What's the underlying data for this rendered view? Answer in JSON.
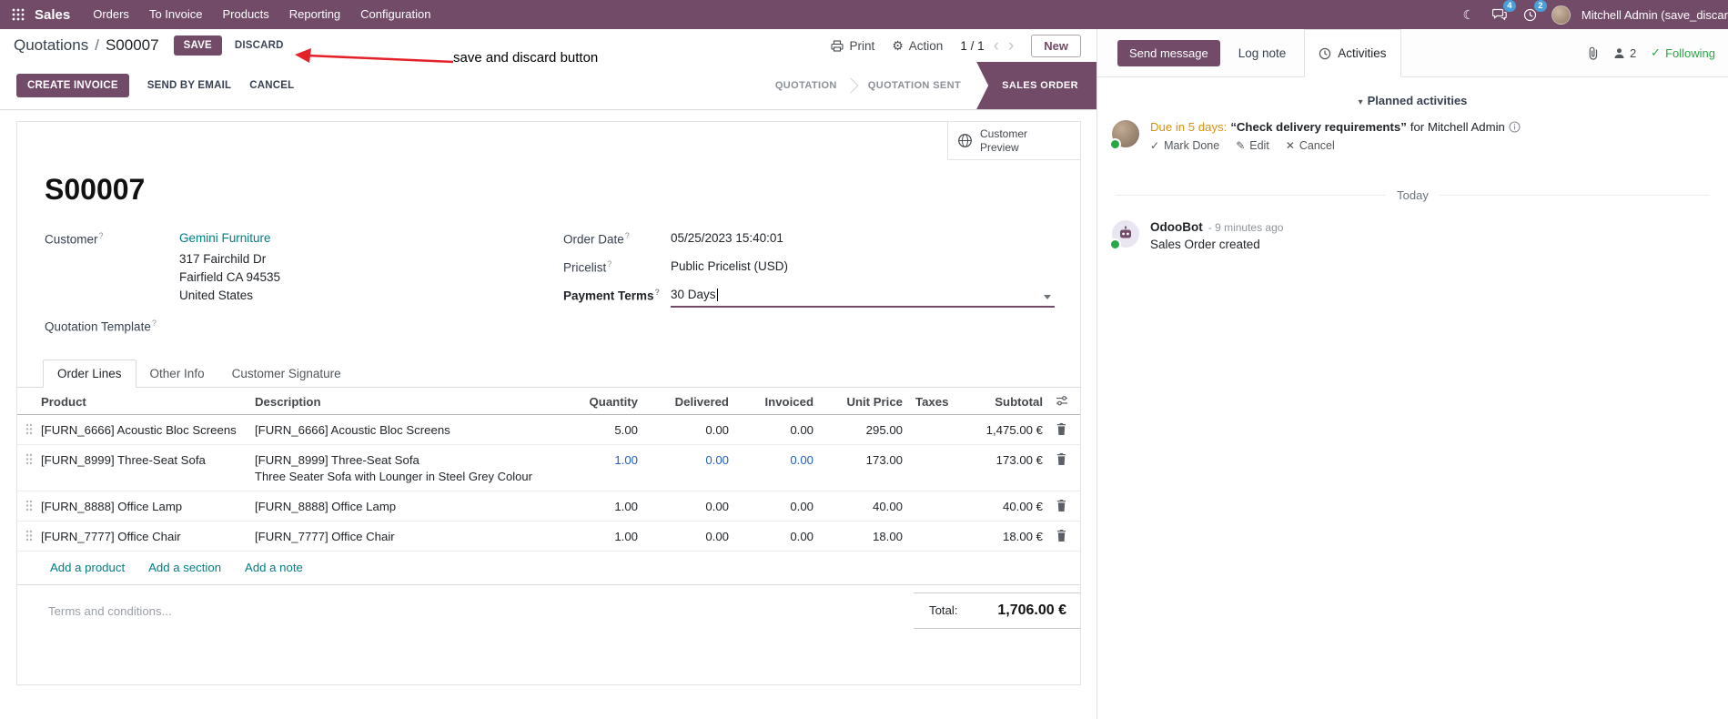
{
  "colors": {
    "primary": "#714B67",
    "link_teal": "#017e84",
    "modified_value_blue": "#2160c4",
    "following_green": "#28a745",
    "activity_due_orange": "#d9930d",
    "annotation_red": "#e32228",
    "topbar_badge_blue": "#4a9ed9"
  },
  "icons": {
    "gear": "⚙",
    "moon": "☾",
    "chevron_left": "‹",
    "chevron_right": "›",
    "caret_down": "▾",
    "check": "✓",
    "pencil": "✎",
    "cross": "✕"
  },
  "topbar": {
    "brand": "Sales",
    "menus": [
      "Orders",
      "To Invoice",
      "Products",
      "Reporting",
      "Configuration"
    ],
    "messages_badge": "4",
    "activities_badge": "2",
    "user_name": "Mitchell Admin (save_discar"
  },
  "control_panel": {
    "breadcrumb_parent": "Quotations",
    "separator": "/",
    "breadcrumb_current": "S00007",
    "save": "SAVE",
    "discard": "DISCARD",
    "print": "Print",
    "action": "Action",
    "pager": "1 / 1",
    "new": "New"
  },
  "annotation": {
    "label": "save and discard button"
  },
  "statusbar": {
    "create_invoice": "CREATE INVOICE",
    "send_by_email": "SEND BY EMAIL",
    "cancel": "CANCEL",
    "steps": [
      "QUOTATION",
      "QUOTATION SENT",
      "SALES ORDER"
    ]
  },
  "sheet": {
    "customer_preview": "Customer Preview",
    "title": "S00007",
    "help_marker": "?",
    "fields": {
      "customer_label": "Customer",
      "customer_value": "Gemini Furniture",
      "customer_address": [
        "317 Fairchild Dr",
        "Fairfield CA 94535",
        "United States"
      ],
      "quotation_template_label": "Quotation Template",
      "order_date_label": "Order Date",
      "order_date_value": "05/25/2023 15:40:01",
      "pricelist_label": "Pricelist",
      "pricelist_value": "Public Pricelist (USD)",
      "payment_terms_label": "Payment Terms",
      "payment_terms_value": "30 Days"
    },
    "tabs": [
      "Order Lines",
      "Other Info",
      "Customer Signature"
    ],
    "table": {
      "headers": [
        "Product",
        "Description",
        "Quantity",
        "Delivered",
        "Invoiced",
        "Unit Price",
        "Taxes",
        "Subtotal"
      ],
      "rows": [
        {
          "product": "[FURN_6666] Acoustic Bloc Screens",
          "description": "[FURN_6666] Acoustic Bloc Screens",
          "description2": "",
          "quantity": "5.00",
          "delivered": "0.00",
          "invoiced": "0.00",
          "unit_price": "295.00",
          "taxes": "",
          "subtotal": "1,475.00 €"
        },
        {
          "product": "[FURN_8999] Three-Seat Sofa",
          "description": "[FURN_8999] Three-Seat Sofa",
          "description2": "Three Seater Sofa with Lounger in Steel Grey Colour",
          "quantity": "1.00",
          "delivered": "0.00",
          "invoiced": "0.00",
          "unit_price": "173.00",
          "taxes": "",
          "subtotal": "173.00 €"
        },
        {
          "product": "[FURN_8888] Office Lamp",
          "description": "[FURN_8888] Office Lamp",
          "description2": "",
          "quantity": "1.00",
          "delivered": "0.00",
          "invoiced": "0.00",
          "unit_price": "40.00",
          "taxes": "",
          "subtotal": "40.00 €"
        },
        {
          "product": "[FURN_7777] Office Chair",
          "description": "[FURN_7777] Office Chair",
          "description2": "",
          "quantity": "1.00",
          "delivered": "0.00",
          "invoiced": "0.00",
          "unit_price": "18.00",
          "taxes": "",
          "subtotal": "18.00 €"
        }
      ],
      "footer_links": [
        "Add a product",
        "Add a section",
        "Add a note"
      ],
      "terms_placeholder": "Terms and conditions...",
      "total_label": "Total:",
      "total_value": "1,706.00 €"
    }
  },
  "chatter": {
    "send_message": "Send message",
    "log_note": "Log note",
    "activities_tab": "Activities",
    "followers_count": "2",
    "following": "Following",
    "planned_activities": "Planned activities",
    "activity": {
      "due": "Due in 5 days:",
      "summary": "“Check delivery requirements”",
      "for_user": "for Mitchell Admin",
      "mark_done": "Mark Done",
      "edit": "Edit",
      "cancel": "Cancel"
    },
    "date_divider": "Today",
    "message": {
      "author": "OdooBot",
      "time": "- 9 minutes ago",
      "body": "Sales Order created"
    }
  }
}
